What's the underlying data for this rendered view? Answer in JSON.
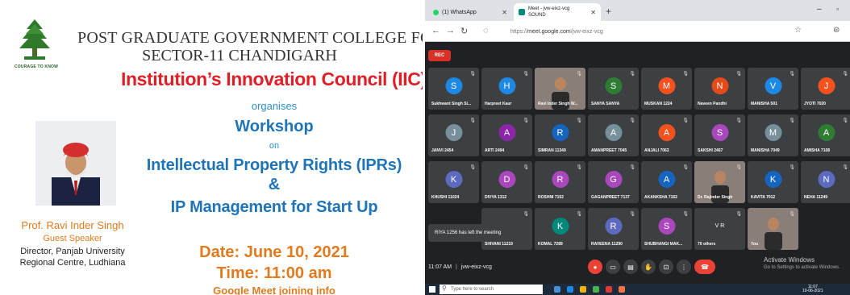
{
  "poster": {
    "logo_motto": "COURAGE TO KNOW",
    "college": "POST GRADUATE GOVERNMENT COLLEGE FOR G",
    "sector": "SECTOR-11 CHANDIGARH",
    "iic": "Institution’s Innovation Council (IIC)",
    "organises": "organises",
    "workshop": "Workshop",
    "on": "on",
    "topic1": "Intellectual Property Rights (IPRs)",
    "amp": "&",
    "topic2": "IP Management for Start Up",
    "date": "Date: June 10, 2021",
    "time": "Time: 11:00 am",
    "gm_info": "Google Meet joining info",
    "speaker": {
      "name": "Prof. Ravi Inder Singh",
      "role": "Guest Speaker",
      "director": "Director, Panjab University",
      "region": "Regional Centre, Ludhiana"
    }
  },
  "browser": {
    "tab1": "(1) WhatsApp",
    "tab2_title": "Meet - jvw-eixz-vcg",
    "tab2_sub": "SOUND",
    "url_prefix": "https://",
    "url_host": "meet.google.com",
    "url_path": "/jvw-eixz-vcg",
    "rec": "REC",
    "toast": "RIYA 1256 has left the meeting",
    "footer_time": "11:07 AM",
    "footer_code": "jvw-eixz-vcg",
    "activate_title": "Activate Windows",
    "activate_sub": "Go to Settings to activate Windows.",
    "taskbar_search": "Type here to search",
    "tray_time": "11:07",
    "tray_date": "10-06-2021",
    "tiles": [
      {
        "name": "Sukhwant Singh Si...",
        "letter": "S",
        "color": "#1e88e5"
      },
      {
        "name": "Harpreet Kaur",
        "letter": "H",
        "color": "#1e88e5"
      },
      {
        "name": "Ravi Inder Singh W...",
        "letter": "",
        "color": "",
        "video": true
      },
      {
        "name": "SANYA SANYA",
        "letter": "S",
        "color": "#2e7d32"
      },
      {
        "name": "MUSKAN 1224",
        "letter": "M",
        "color": "#f4511e"
      },
      {
        "name": "Naveen Pandhi",
        "letter": "N",
        "color": "#e64a19"
      },
      {
        "name": "MANISHA 501",
        "letter": "V",
        "color": "#1e88e5"
      },
      {
        "name": "JYOTI 7020",
        "letter": "J",
        "color": "#f4511e"
      },
      {
        "name": "JANVI 2454",
        "letter": "J",
        "color": "#78909c"
      },
      {
        "name": "ARTI 2494",
        "letter": "A",
        "color": "#8e24aa"
      },
      {
        "name": "SIMRAN 11349",
        "letter": "R",
        "color": "#1565c0"
      },
      {
        "name": "AMANPREET 7045",
        "letter": "A",
        "color": "#78909c"
      },
      {
        "name": "ANJALI 7063",
        "letter": "A",
        "color": "#f4511e"
      },
      {
        "name": "SAKSHI 2467",
        "letter": "S",
        "color": "#ab47bc"
      },
      {
        "name": "MANISHA 7049",
        "letter": "M",
        "color": "#78909c"
      },
      {
        "name": "AMISHA 7108",
        "letter": "A",
        "color": "#2e7d32"
      },
      {
        "name": "KHUSHI 11024",
        "letter": "K",
        "color": "#5c6bc0"
      },
      {
        "name": "DIVYA 1312",
        "letter": "D",
        "color": "#ab47bc"
      },
      {
        "name": "ROSHNI 7152",
        "letter": "R",
        "color": "#ab47bc"
      },
      {
        "name": "GAGANPREET 7137",
        "letter": "G",
        "color": "#ab47bc"
      },
      {
        "name": "AKANKSHA 7162",
        "letter": "A",
        "color": "#1565c0"
      },
      {
        "name": "Dr. Rajinder Singh",
        "letter": "",
        "color": "",
        "video": true
      },
      {
        "name": "KAVITA 7012",
        "letter": "K",
        "color": "#1565c0"
      },
      {
        "name": "NEHA 11249",
        "letter": "N",
        "color": "#5c6bc0"
      },
      {
        "name": "",
        "letter": "",
        "color": ""
      },
      {
        "name": "SHIVANI 11219",
        "letter": "",
        "color": ""
      },
      {
        "name": "KOMAL 7289",
        "letter": "K",
        "color": "#00897b"
      },
      {
        "name": "RAVEENA 11290",
        "letter": "R",
        "color": "#5c6bc0"
      },
      {
        "name": "SHUBHANGI MAK...",
        "letter": "S",
        "color": "#ab47bc"
      },
      {
        "name": "70 others",
        "letter": "V R",
        "color": "#3c4043"
      },
      {
        "name": "You",
        "letter": "",
        "color": "",
        "video": true
      }
    ]
  }
}
